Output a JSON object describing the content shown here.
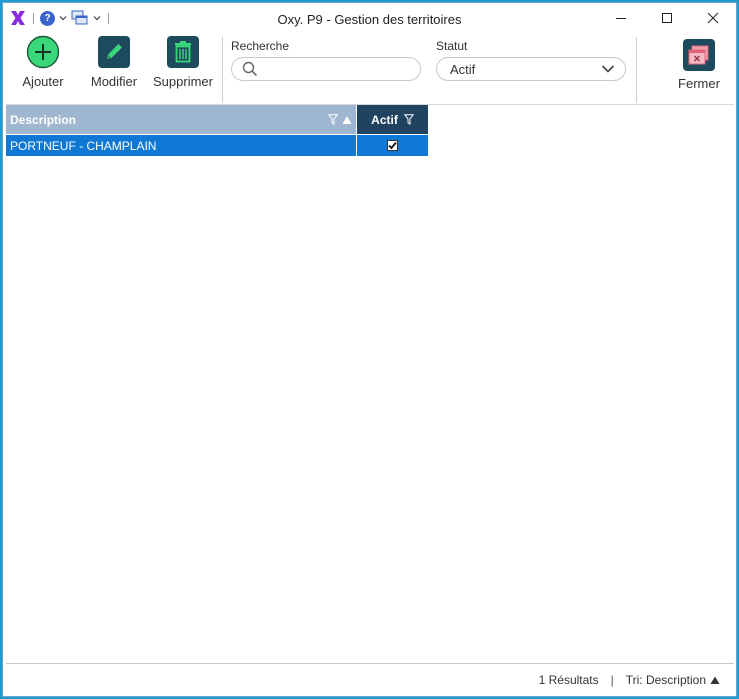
{
  "window": {
    "title": "Oxy. P9 - Gestion des territoires"
  },
  "toolbar": {
    "add_label": "Ajouter",
    "edit_label": "Modifier",
    "delete_label": "Supprimer",
    "close_label": "Fermer",
    "search_label": "Recherche",
    "search_value": "",
    "status_label": "Statut",
    "status_value": "Actif"
  },
  "grid": {
    "columns": [
      "Description",
      "Actif"
    ],
    "rows": [
      {
        "description": "PORTNEUF - CHAMPLAIN",
        "actif": true
      }
    ]
  },
  "statusbar": {
    "results": "1 Résultats",
    "separator": "|",
    "sort": "Tri: Description"
  },
  "colors": {
    "accent_green": "#3ad67a",
    "toolbar_teal": "#1d4a5c",
    "selection": "#0e78d4",
    "header_desc": "#9fb6d0",
    "header_actif": "#1f4360",
    "close_icon": "#e0657a",
    "logo": "#8a2be2"
  },
  "icons": [
    "app-logo",
    "help-icon",
    "windows-icon",
    "add-icon",
    "edit-icon",
    "trash-icon",
    "search-icon",
    "chevron-down-icon",
    "filter-icon",
    "sort-asc-icon",
    "close-window-icon"
  ]
}
